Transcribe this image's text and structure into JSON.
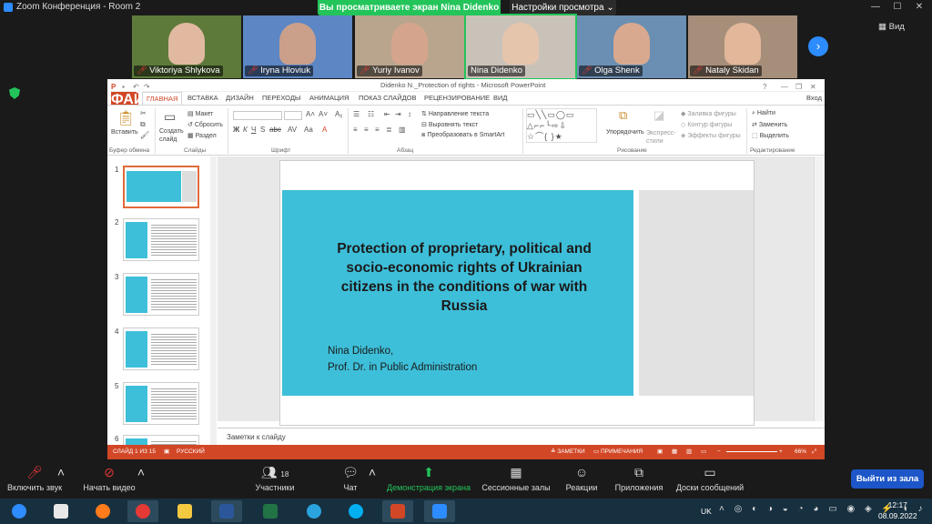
{
  "zoom": {
    "window_title": "Zoom Конференция - Room 2",
    "share_banner": "Вы просматриваете экран Nina Didenko",
    "view_settings": "Настройки просмотра",
    "view_label": "Вид",
    "participants": [
      {
        "name": "Viktoriya Shlykova"
      },
      {
        "name": "Iryna Hloviuk"
      },
      {
        "name": "Yuriy Ivanov"
      },
      {
        "name": "Nina Didenko"
      },
      {
        "name": "Olga Shenk"
      },
      {
        "name": "Nataly Skidan"
      }
    ],
    "toolbar": {
      "mute": "Включить звук",
      "video": "Начать видео",
      "participants": "Участники",
      "participants_count": "18",
      "chat": "Чат",
      "share": "Демонстрация экрана",
      "breakout": "Сессионные залы",
      "reactions": "Реакции",
      "apps": "Приложения",
      "whiteboards": "Доски сообщений",
      "leave": "Выйти из зала"
    }
  },
  "ppt": {
    "title": "Didenko N._Protection of rights - Microsoft PowerPoint",
    "tabs": [
      "ФАЙЛ",
      "ГЛАВНАЯ",
      "ВСТАВКА",
      "ДИЗАЙН",
      "ПЕРЕХОДЫ",
      "АНИМАЦИЯ",
      "ПОКАЗ СЛАЙДОВ",
      "РЕЦЕНЗИРОВАНИЕ",
      "ВИД"
    ],
    "signin": "Вход",
    "ribbon": {
      "paste": "Вставить",
      "clipboard": "Буфер обмена",
      "new_slide": "Создать слайд",
      "layout": "Макет",
      "reset": "Сбросить",
      "section": "Раздел",
      "slides": "Слайды",
      "font": "Шрифт",
      "paragraph": "Абзац",
      "text_direction": "Направление текста",
      "align_text": "Выровнять текст",
      "smartart": "Преобразовать в SmartArt",
      "arrange": "Упорядочить",
      "quick_styles": "Экспресс-стили",
      "shape_fill": "Заливка фигуры",
      "shape_outline": "Контур фигуры",
      "shape_effects": "Эффекты фигуры",
      "drawing": "Рисование",
      "find": "Найти",
      "replace": "Заменить",
      "select": "Выделить",
      "editing": "Редактирование"
    },
    "thumb_numbers": [
      "1",
      "2",
      "3",
      "4",
      "5",
      "6"
    ],
    "slide": {
      "title": "Protection of proprietary, political and socio-economic rights of Ukrainian citizens in the conditions of war with Russia",
      "author_line1": "Nina Didenko,",
      "author_line2": "Prof. Dr. in Public Administration"
    },
    "notes_placeholder": "Заметки к слайду",
    "status": {
      "slide_counter": "СЛАЙД 1 ИЗ 15",
      "language": "РУССКИЙ",
      "notes": "ЗАМЕТКИ",
      "comments": "ПРИМЕЧАНИЯ",
      "zoom": "66%"
    }
  },
  "taskbar": {
    "lang": "UK",
    "time": "12:17",
    "date": "08.09.2022"
  }
}
